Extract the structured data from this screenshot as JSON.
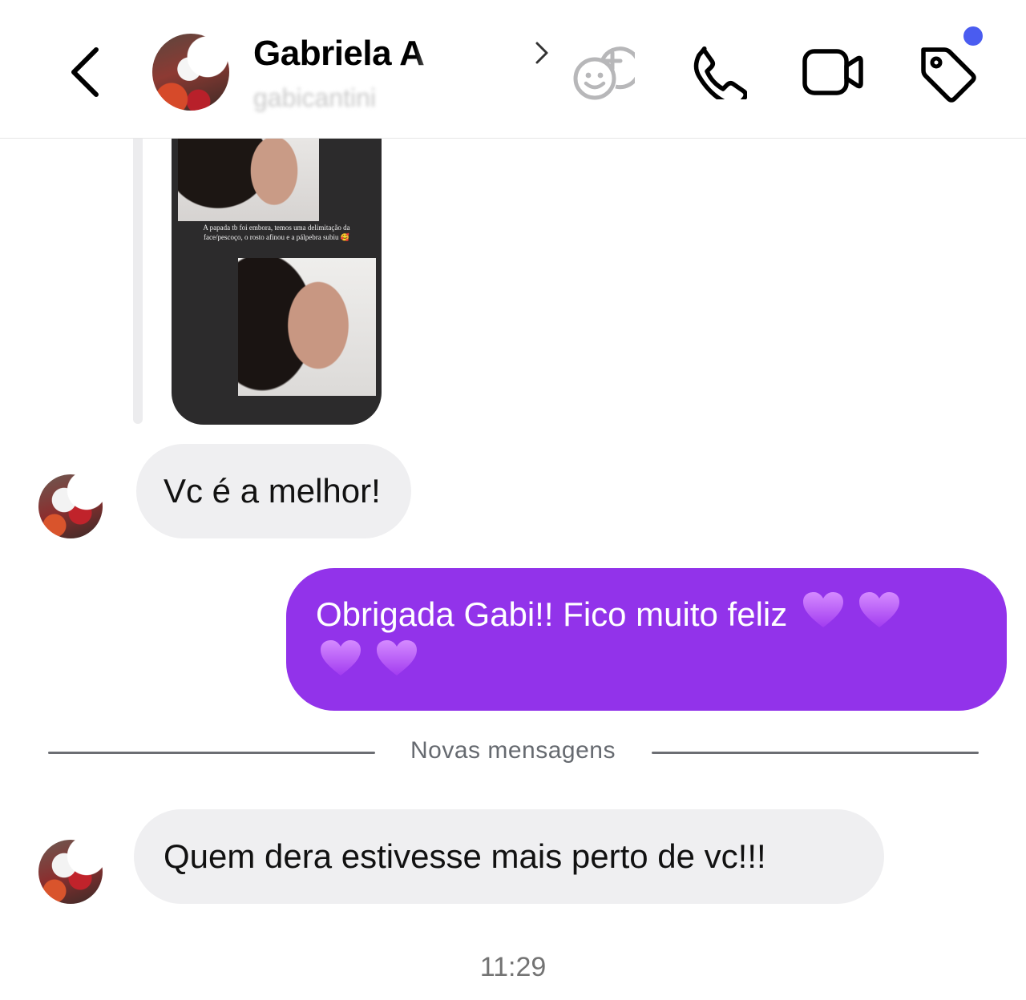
{
  "header": {
    "contact_name": "Gabriela A",
    "contact_username": "gabicantini",
    "notification_color": "#4a5cf0",
    "icons": [
      "back-arrow-icon",
      "avatar",
      "chevron-right-icon",
      "add-friend-sticker-icon",
      "phone-icon",
      "video-camera-icon",
      "tag-icon"
    ]
  },
  "story": {
    "caption": "A papada tb foi embora, temos uma delimitação da face/pescoço, o rosto afinou e a pálpebra subiu 🥰"
  },
  "messages": [
    {
      "direction": "incoming",
      "text": "Vc é a melhor!"
    },
    {
      "direction": "outgoing",
      "text": "Obrigada Gabi!! Fico muito feliz",
      "hearts": 4,
      "color": "#9233ea"
    },
    {
      "direction": "incoming",
      "text": "Quem dera estivesse mais perto de vc!!!"
    }
  ],
  "divider": {
    "label": "Novas mensagens"
  },
  "timestamp": "11:29"
}
